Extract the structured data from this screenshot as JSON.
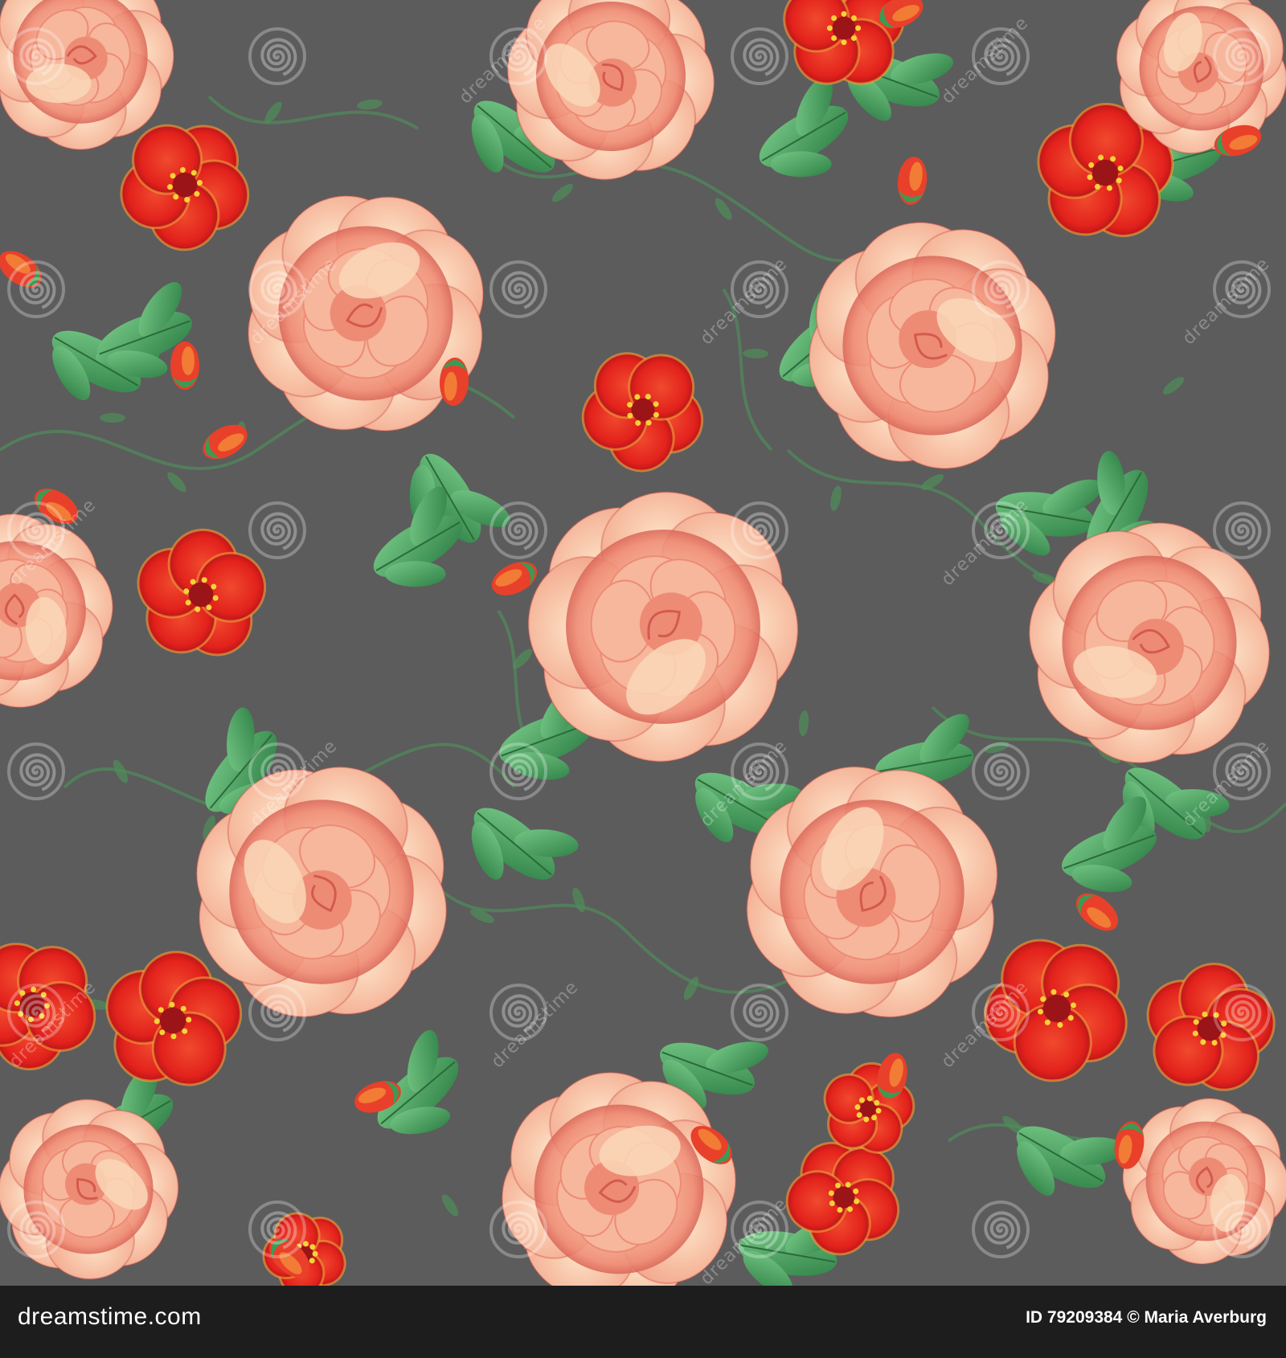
{
  "image": {
    "kind": "seamless floral pattern",
    "background_color": "#5c5c5c",
    "colors": {
      "rose_light": "#f6b79c",
      "rose_mid": "#ee8b75",
      "rose_dark": "#c8463f",
      "rose_center": "#fad7b8",
      "poppy": "#e8251f",
      "poppy_dark": "#b5161a",
      "leaf": "#3d9a55",
      "leaf_light": "#6cc07d",
      "vine": "#4f8f5a"
    },
    "watermark": {
      "text": "dreamstime",
      "icon": "spiral-logo-icon"
    }
  },
  "footer": {
    "brand": "dreamstime.com",
    "credit": "ID 79209384 © Maria Averburg"
  }
}
